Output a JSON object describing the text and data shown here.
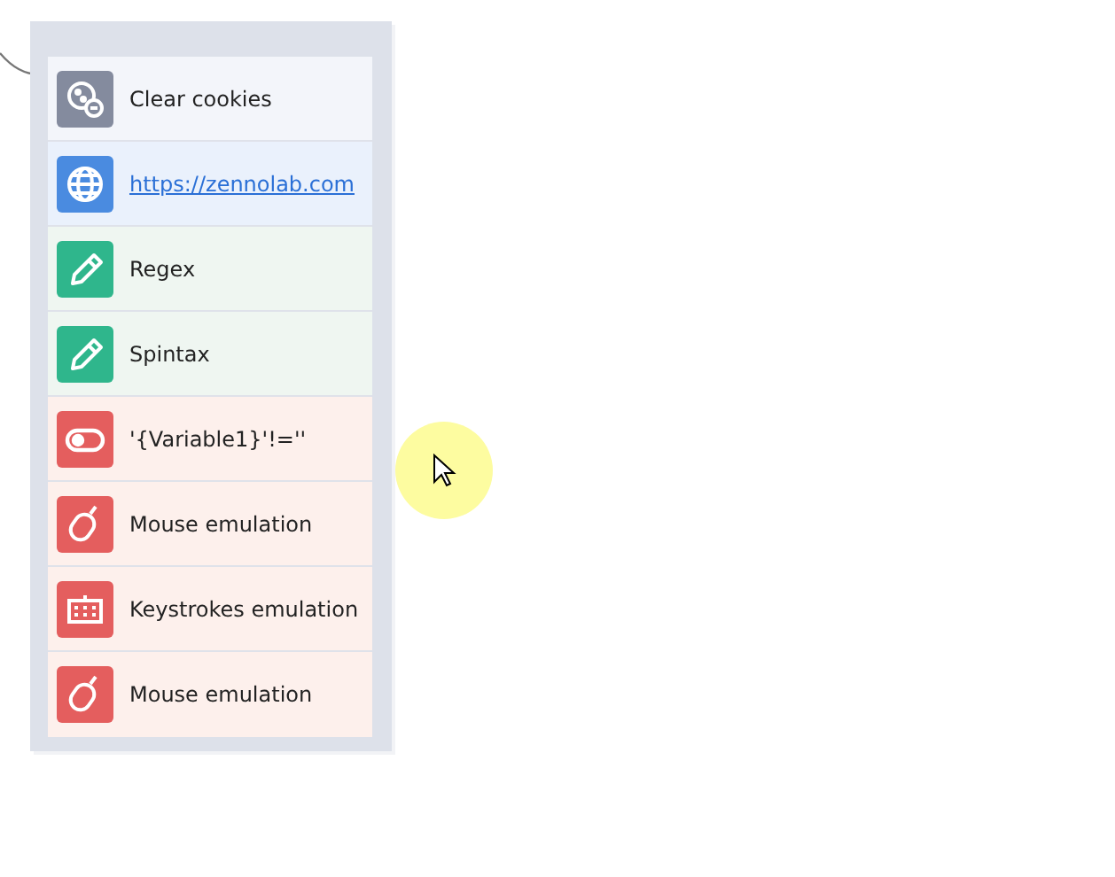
{
  "actions": [
    {
      "kind": "cookies",
      "label": "Clear cookies"
    },
    {
      "kind": "link",
      "label": "https://zennolab.com"
    },
    {
      "kind": "text",
      "label": "Regex"
    },
    {
      "kind": "text",
      "label": "Spintax"
    },
    {
      "kind": "condition",
      "label": "'{Variable1}'!=''"
    },
    {
      "kind": "mouse",
      "label": "Mouse emulation"
    },
    {
      "kind": "keyboard",
      "label": "Keystrokes emulation"
    },
    {
      "kind": "mouse",
      "label": "Mouse emulation"
    }
  ]
}
